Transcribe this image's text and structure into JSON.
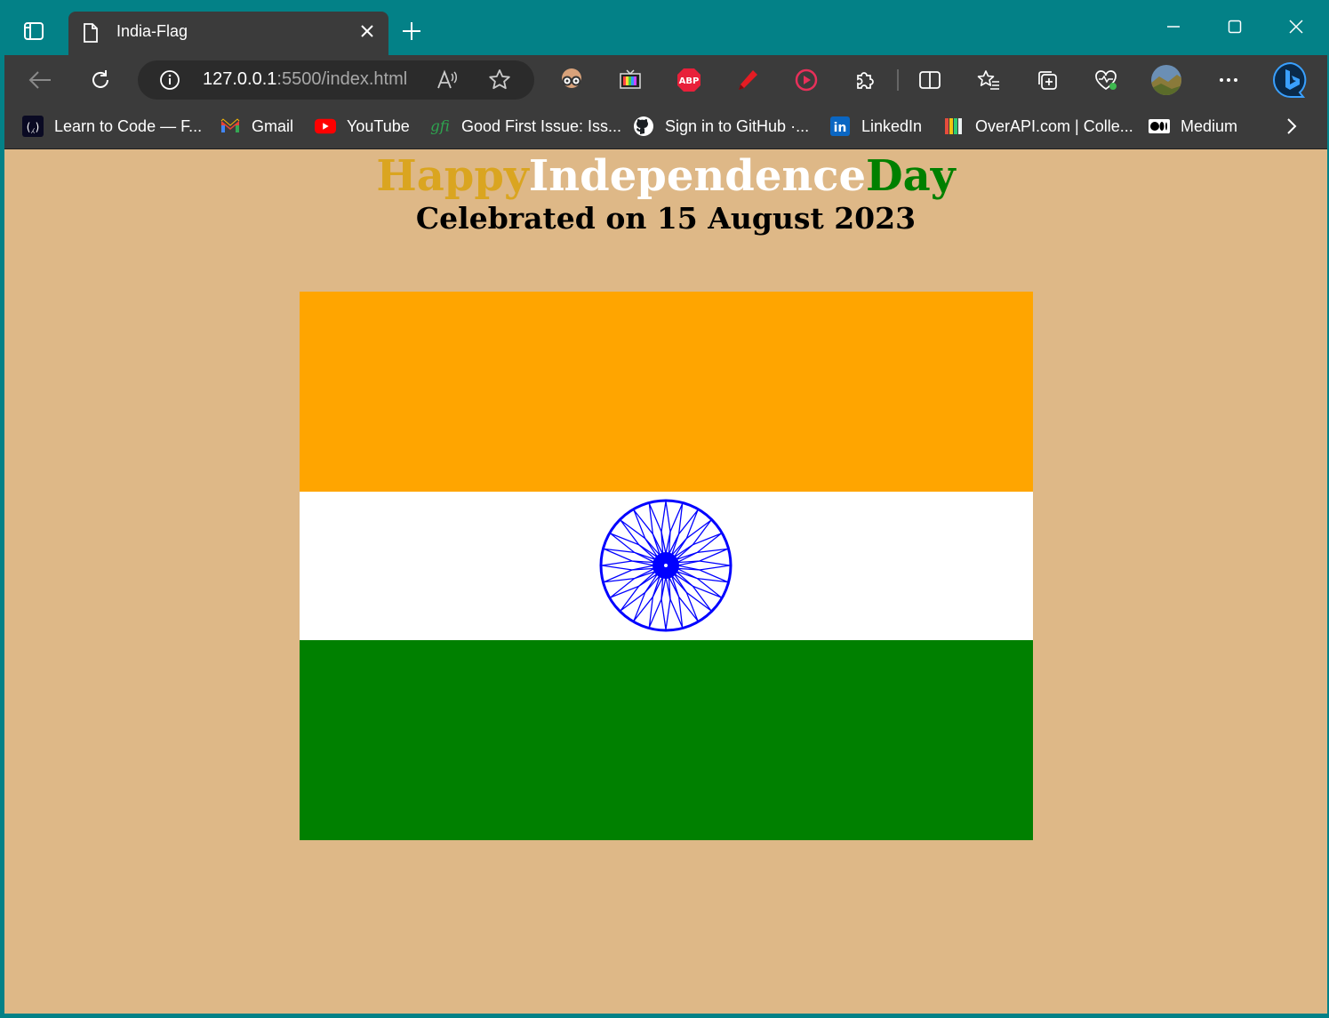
{
  "browser": {
    "tab_title": "India-Flag",
    "url_host": "127.0.0.1",
    "url_path": ":5500/index.html",
    "read_aloud_glyph": "A̧",
    "window_controls": [
      "minimize-icon",
      "maximize-icon",
      "close-icon"
    ],
    "extensions": [
      "reading-glasses-icon",
      "tv-extension-icon",
      "adblock-plus-icon",
      "pen-extension-icon",
      "media-play-icon",
      "extensions-puzzle-icon",
      "split-screen-icon",
      "favorites-icon",
      "collections-icon",
      "browser-essentials-icon",
      "profile-avatar",
      "more-options-icon",
      "bing-copilot-icon"
    ],
    "extension_labels": {
      "adblock": "ABP"
    }
  },
  "bookmarks": [
    {
      "label": "Learn to Code — F...",
      "icon": "freecodecamp-icon"
    },
    {
      "label": "Gmail",
      "icon": "gmail-icon"
    },
    {
      "label": "YouTube",
      "icon": "youtube-icon"
    },
    {
      "label": "Good First Issue: Iss...",
      "icon": "gfi-icon"
    },
    {
      "label": "Sign in to GitHub ·...",
      "icon": "github-icon"
    },
    {
      "label": "LinkedIn",
      "icon": "linkedin-icon"
    },
    {
      "label": "OverAPI.com | Colle...",
      "icon": "overapi-icon"
    },
    {
      "label": "Medium",
      "icon": "medium-icon"
    }
  ],
  "page": {
    "heading": {
      "part1": "Happy",
      "part2": "Independence",
      "part3": "Day"
    },
    "subheading": "Celebrated on 15 August 2023",
    "flag": {
      "colors": {
        "saffron": "#ffa500",
        "white": "#ffffff",
        "green": "#008000",
        "chakra": "#0000ff"
      },
      "chakra_spokes": 24
    },
    "background": "#deb887"
  }
}
